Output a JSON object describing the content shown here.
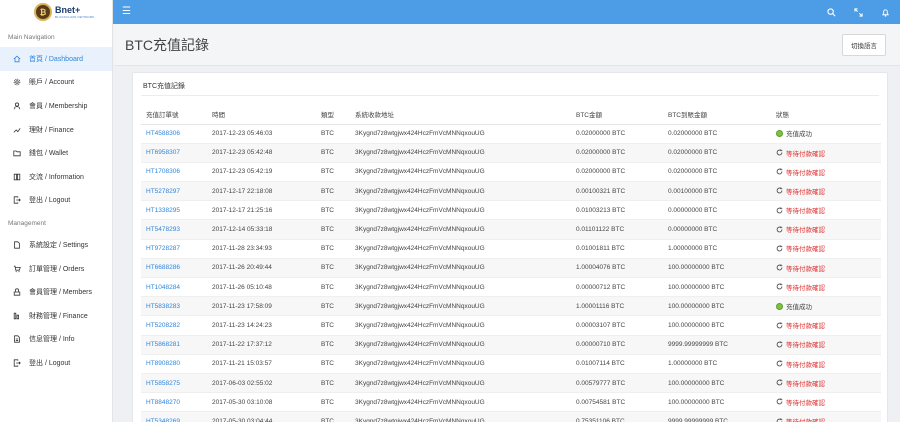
{
  "brand": {
    "name": "Bnet+",
    "sub": "BLOCKCHAIN NETWORK",
    "logo_letter": "₿"
  },
  "sidebar": {
    "main_section": "Main Navigation",
    "items": [
      {
        "label": "首頁 / Dashboard",
        "icon": "home-icon",
        "active": true
      },
      {
        "label": "賬戶 / Account",
        "icon": "cog-icon"
      },
      {
        "label": "會員 / Membership",
        "icon": "user-icon"
      },
      {
        "label": "理財 / Finance",
        "icon": "chart-line-icon"
      },
      {
        "label": "錢包 / Wallet",
        "icon": "folder-icon"
      },
      {
        "label": "交流 / Information",
        "icon": "book-icon"
      },
      {
        "label": "登出 / Logout",
        "icon": "logout-icon"
      }
    ],
    "manage_section": "Management",
    "manage_items": [
      {
        "label": "系統設定 / Settings",
        "icon": "file-icon"
      },
      {
        "label": "訂單管理 / Orders",
        "icon": "cart-icon"
      },
      {
        "label": "會員管理 / Members",
        "icon": "members-icon"
      },
      {
        "label": "財務管理 / Finance",
        "icon": "finance-icon"
      },
      {
        "label": "信息管理 / Info",
        "icon": "info-icon"
      },
      {
        "label": "登出 / Logout",
        "icon": "logout-icon"
      }
    ]
  },
  "page": {
    "title": "BTC充值記錄",
    "switch_label": "切換語言"
  },
  "card": {
    "title": "BTC充值記錄"
  },
  "table": {
    "headers": [
      "充值訂單號",
      "時間",
      "類型",
      "系統收款地址",
      "BTC金額",
      "BTC到賬金額",
      "狀態"
    ],
    "rows": [
      {
        "order": "HT4588306",
        "time": "2017-12-23 05:46:03",
        "type": "BTC",
        "address": "3Kygnd7z8wtgjwx424HczFmVcMNNqxouUG",
        "amount": "0.02000000 BTC",
        "received": "0.02000000 BTC",
        "status": "充值成功",
        "ok": true
      },
      {
        "order": "HT6958307",
        "time": "2017-12-23 05:42:48",
        "type": "BTC",
        "address": "3Kygnd7z8wtgjwx424HczFmVcMNNqxouUG",
        "amount": "0.02000000 BTC",
        "received": "0.02000000 BTC",
        "status": "等待付款確認",
        "ok": false
      },
      {
        "order": "HT1708306",
        "time": "2017-12-23 05:42:19",
        "type": "BTC",
        "address": "3Kygnd7z8wtgjwx424HczFmVcMNNqxouUG",
        "amount": "0.02000000 BTC",
        "received": "0.02000000 BTC",
        "status": "等待付款確認",
        "ok": false
      },
      {
        "order": "HT5278297",
        "time": "2017-12-17 22:18:08",
        "type": "BTC",
        "address": "3Kygnd7z8wtgjwx424HczFmVcMNNqxouUG",
        "amount": "0.00100321 BTC",
        "received": "0.00100000 BTC",
        "status": "等待付款確認",
        "ok": false
      },
      {
        "order": "HT1338295",
        "time": "2017-12-17 21:25:16",
        "type": "BTC",
        "address": "3Kygnd7z8wtgjwx424HczFmVcMNNqxouUG",
        "amount": "0.01003213 BTC",
        "received": "0.00000000 BTC",
        "status": "等待付款確認",
        "ok": false
      },
      {
        "order": "HT5478293",
        "time": "2017-12-14 05:33:18",
        "type": "BTC",
        "address": "3Kygnd7z8wtgjwx424HczFmVcMNNqxouUG",
        "amount": "0.01101122 BTC",
        "received": "0.00000000 BTC",
        "status": "等待付款確認",
        "ok": false
      },
      {
        "order": "HT9728287",
        "time": "2017-11-28 23:34:93",
        "type": "BTC",
        "address": "3Kygnd7z8wtgjwx424HczFmVcMNNqxouUG",
        "amount": "0.01001811 BTC",
        "received": "1.00000000 BTC",
        "status": "等待付款確認",
        "ok": false
      },
      {
        "order": "HT6688286",
        "time": "2017-11-26 20:49:44",
        "type": "BTC",
        "address": "3Kygnd7z8wtgjwx424HczFmVcMNNqxouUG",
        "amount": "1.00004076 BTC",
        "received": "100.00000000 BTC",
        "status": "等待付款確認",
        "ok": false
      },
      {
        "order": "HT1048284",
        "time": "2017-11-26 05:10:48",
        "type": "BTC",
        "address": "3Kygnd7z8wtgjwx424HczFmVcMNNqxouUG",
        "amount": "0.00000712 BTC",
        "received": "100.00000000 BTC",
        "status": "等待付款確認",
        "ok": false
      },
      {
        "order": "HT5838283",
        "time": "2017-11-23 17:58:09",
        "type": "BTC",
        "address": "3Kygnd7z8wtgjwx424HczFmVcMNNqxouUG",
        "amount": "1.00001116 BTC",
        "received": "100.00000000 BTC",
        "status": "充值成功",
        "ok": true
      },
      {
        "order": "HT5208282",
        "time": "2017-11-23 14:24:23",
        "type": "BTC",
        "address": "3Kygnd7z8wtgjwx424HczFmVcMNNqxouUG",
        "amount": "0.00003107 BTC",
        "received": "100.00000000 BTC",
        "status": "等待付款確認",
        "ok": false
      },
      {
        "order": "HT5868281",
        "time": "2017-11-22 17:37:12",
        "type": "BTC",
        "address": "3Kygnd7z8wtgjwx424HczFmVcMNNqxouUG",
        "amount": "0.00000710 BTC",
        "received": "9999.99999999 BTC",
        "status": "等待付款確認",
        "ok": false
      },
      {
        "order": "HT8908280",
        "time": "2017-11-21 15:03:57",
        "type": "BTC",
        "address": "3Kygnd7z8wtgjwx424HczFmVcMNNqxouUG",
        "amount": "0.01007114 BTC",
        "received": "1.00000000 BTC",
        "status": "等待付款確認",
        "ok": false
      },
      {
        "order": "HT5858275",
        "time": "2017-06-03 02:55:02",
        "type": "BTC",
        "address": "3Kygnd7z8wtgjwx424HczFmVcMNNqxouUG",
        "amount": "0.00579777 BTC",
        "received": "100.00000000 BTC",
        "status": "等待付款確認",
        "ok": false
      },
      {
        "order": "HT8848270",
        "time": "2017-05-30 03:10:08",
        "type": "BTC",
        "address": "3Kygnd7z8wtgjwx424HczFmVcMNNqxouUG",
        "amount": "0.00754581 BTC",
        "received": "100.00000000 BTC",
        "status": "等待付款確認",
        "ok": false
      },
      {
        "order": "HT5348269",
        "time": "2017-05-30 03:04:44",
        "type": "BTC",
        "address": "3Kygnd7z8wtgjwx424HczFmVcMNNqxouUG",
        "amount": "0.75351106 BTC",
        "received": "9999.99999999 BTC",
        "status": "等待付款確認",
        "ok": false
      }
    ]
  },
  "topbar_icons": [
    "search-icon",
    "expand-icon",
    "bell-icon"
  ],
  "colors": {
    "topbar": "#4d9de6",
    "link": "#2e86de",
    "pending": "#e02b2b",
    "success": "#7cc243"
  }
}
